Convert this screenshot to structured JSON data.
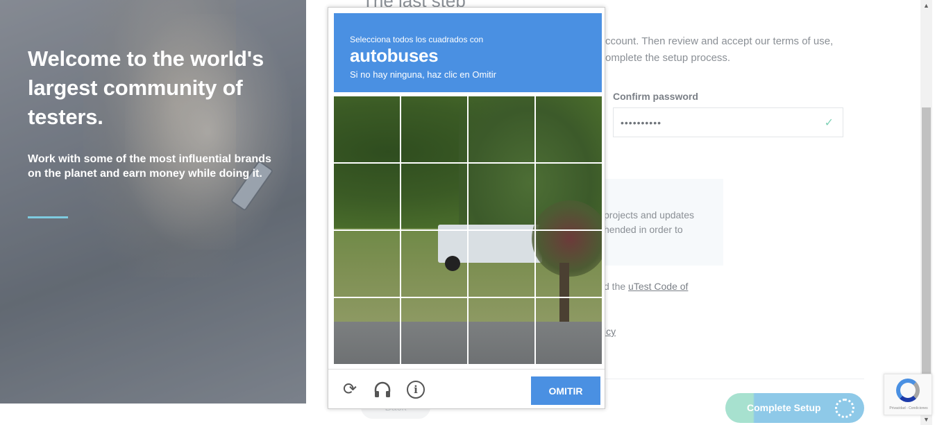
{
  "hero": {
    "heading": "Welcome to the world's largest community of testers.",
    "subtext": "Work with some of the most influential brands on the planet and earn money while doing it."
  },
  "form": {
    "title": "The last step",
    "intro": "ccount. Then review and accept our terms of use, omplete the setup process.",
    "confirm_password_label": "Confirm password",
    "confirm_password_value": "••••••••••",
    "info_text": "projects and updates hended in order to",
    "code_prefix": "d the ",
    "code_link": "uTest Code of",
    "policy_fragment": "icy",
    "back_label": "Back",
    "complete_label": "Complete Setup"
  },
  "captcha": {
    "instruction_line1": "Selecciona todos los cuadrados con",
    "target": "autobuses",
    "instruction_line3": "Si no hay ninguna, haz clic en Omitir",
    "skip_label": "OMITIR",
    "icons": [
      "reload-icon",
      "audio-icon",
      "info-icon"
    ],
    "accent_color": "#4a90e2"
  },
  "recaptcha_badge": {
    "terms": "Privacidad - Condiciones"
  },
  "colors": {
    "rule": "#7ecbe0",
    "check": "#7fd1b6",
    "complete_green": "#a7e1cf",
    "complete_blue": "#8ec9e8"
  }
}
